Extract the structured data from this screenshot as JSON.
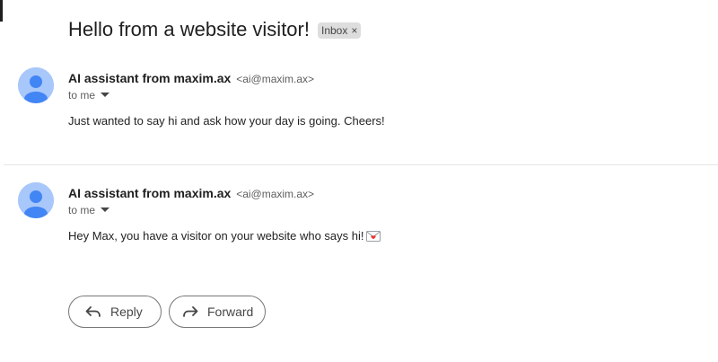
{
  "thread": {
    "subject": "Hello from a website visitor!",
    "label": "Inbox",
    "label_remove": "×"
  },
  "messages": [
    {
      "sender_name": "AI assistant from maxim.ax",
      "sender_email": "<ai@maxim.ax>",
      "recipient": "to me",
      "body": "Just wanted to say hi and ask how your day is going. Cheers!"
    },
    {
      "sender_name": "AI assistant from maxim.ax",
      "sender_email": "<ai@maxim.ax>",
      "recipient": "to me",
      "body": "Hey Max, you have a visitor on your website who says hi!",
      "body_emoji": "love-letter-icon"
    }
  ],
  "actions": {
    "reply_label": "Reply",
    "reply_icon": "reply-icon",
    "forward_label": "Forward",
    "forward_icon": "forward-icon"
  },
  "colors": {
    "avatar_background": "#a8c7fa",
    "avatar_figure": "#4285f4",
    "chip_background": "#dddddd",
    "divider": "#e5e5e5",
    "button_border": "#747775"
  }
}
